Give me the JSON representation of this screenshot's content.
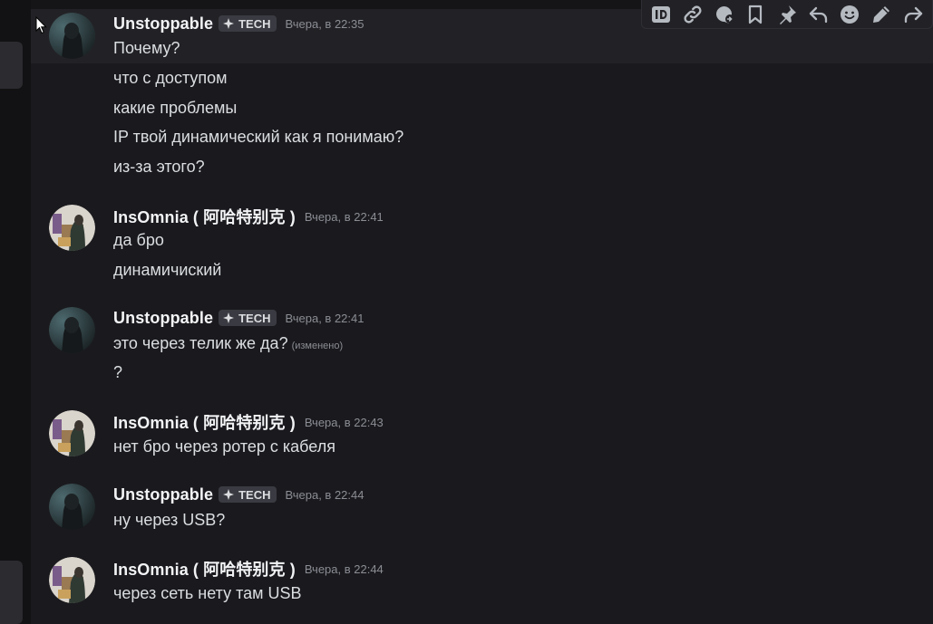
{
  "toolbar": {
    "icons": [
      "id-icon",
      "link-icon",
      "thread-reply-icon",
      "bookmark-icon",
      "pin-icon",
      "reply-icon",
      "emoji-icon",
      "edit-icon",
      "forward-icon"
    ]
  },
  "messages": [
    {
      "username": "Unstoppable",
      "tag": "TECH",
      "timestamp": "Вчера, в 22:35",
      "lines": [
        "Почему?",
        "что с доступом",
        "какие проблемы",
        "IP твой динамический как я понимаю?",
        "из-за этого?"
      ]
    },
    {
      "username": "InsOmnia ( 阿哈特别克 )",
      "timestamp": "Вчера, в 22:41",
      "lines": [
        "да бро",
        "динамичиский"
      ]
    },
    {
      "username": "Unstoppable",
      "tag": "TECH",
      "timestamp": "Вчера, в 22:41",
      "lines": [
        "это через телик же да?",
        "?"
      ],
      "edited_label": "(изменено)"
    },
    {
      "username": "InsOmnia ( 阿哈特别克 )",
      "timestamp": "Вчера, в 22:43",
      "lines": [
        "нет бро через ротер с кабеля"
      ]
    },
    {
      "username": "Unstoppable",
      "tag": "TECH",
      "timestamp": "Вчера, в 22:44",
      "lines": [
        "ну через USB?"
      ]
    },
    {
      "username": "InsOmnia ( 阿哈特别克 )",
      "timestamp": "Вчера, в 22:44",
      "lines": [
        "через сеть нету там USB"
      ]
    }
  ],
  "colors": {
    "background": "#1a1a1e",
    "hover": "#222226",
    "username": "#f2f3f5",
    "text": "#dbdee1",
    "timestamp": "#8b8d95",
    "tag_bg": "#3a3b42",
    "icon": "#b5bac1"
  }
}
